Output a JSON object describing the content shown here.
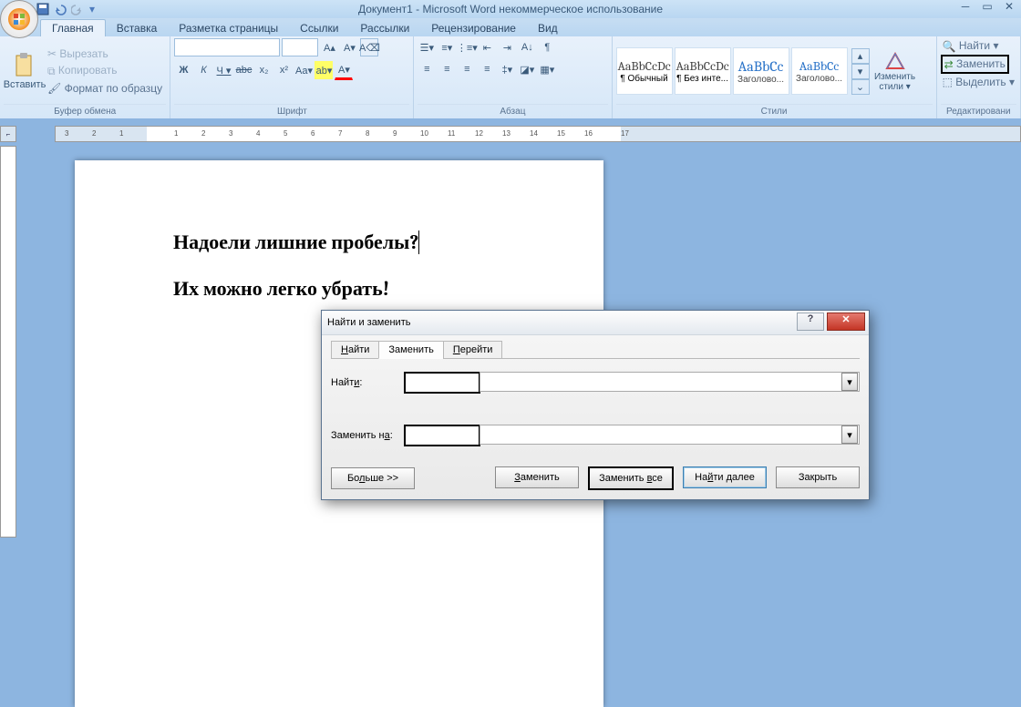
{
  "title": "Документ1 - Microsoft Word некоммерческое использование",
  "tabs": {
    "home": "Главная",
    "insert": "Вставка",
    "layout": "Разметка страницы",
    "refs": "Ссылки",
    "mail": "Рассылки",
    "review": "Рецензирование",
    "view": "Вид"
  },
  "ribbon": {
    "clipboard": {
      "paste": "Вставить",
      "cut": "Вырезать",
      "copy": "Копировать",
      "format_painter": "Формат по образцу",
      "label": "Буфер обмена"
    },
    "font": {
      "label": "Шрифт"
    },
    "paragraph": {
      "label": "Абзац"
    },
    "styles": {
      "s1_preview": "AaBbCcDc",
      "s1": "¶ Обычный",
      "s2_preview": "AaBbCcDc",
      "s2": "¶ Без инте...",
      "s3_preview": "AaBbCc",
      "s3": "Заголово...",
      "s4_preview": "AaBbCc",
      "s4": "Заголово...",
      "change": "Изменить стили ▾",
      "label": "Стили"
    },
    "editing": {
      "find": "Найти ▾",
      "replace": "Заменить",
      "select": "Выделить ▾",
      "label": "Редактировани"
    }
  },
  "document": {
    "line1": "Надоели лишние  пробелы?",
    "line2": "Их можно легко    убрать!"
  },
  "dialog": {
    "title": "Найти и заменить",
    "tab_find": "Найти",
    "tab_replace": "Заменить",
    "tab_goto": "Перейти",
    "lbl_find": "Найти:",
    "lbl_replace": "Заменить на:",
    "btn_more": "Больше >>",
    "btn_replace": "Заменить",
    "btn_replace_all": "Заменить все",
    "btn_find_next": "Найти далее",
    "btn_close": "Закрыть"
  },
  "ruler_corner": "⌐"
}
